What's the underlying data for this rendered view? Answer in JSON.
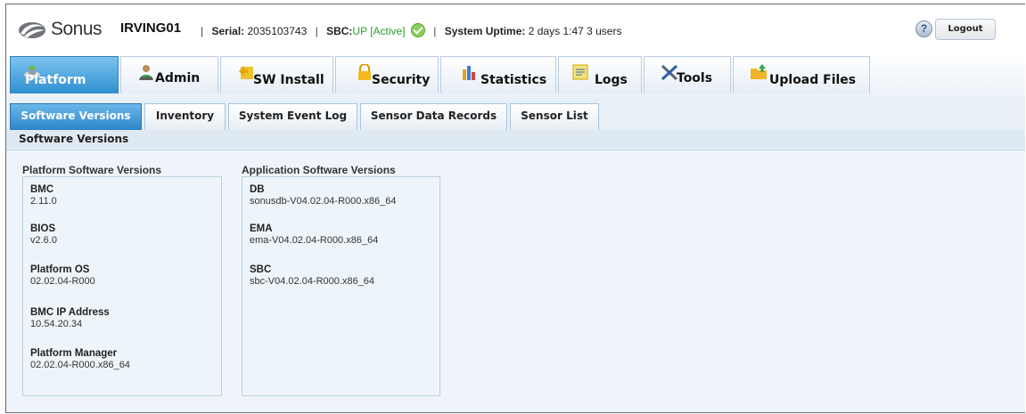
{
  "header": {
    "brand": "Sonus",
    "hostname": "IRVING01",
    "serial_label": "Serial:",
    "serial_value": "2035103743",
    "sbc_label": "SBC:",
    "sbc_status": "UP [Active]",
    "uptime_label": "System Uptime:",
    "uptime_value": "2 days 1:47 3 users",
    "separator": "|",
    "help_symbol": "?",
    "logout_label": "Logout",
    "colors": {
      "status_green": "#2e9d2e",
      "accent_blue": "#2f8fd0"
    }
  },
  "main_tabs": [
    {
      "label": "Platform",
      "icon": "platform-icon",
      "active": true
    },
    {
      "label": "Admin",
      "icon": "admin-user-icon",
      "active": false
    },
    {
      "label": "SW Install",
      "icon": "install-icon",
      "active": false
    },
    {
      "label": "Security",
      "icon": "lock-icon",
      "active": false
    },
    {
      "label": "Statistics",
      "icon": "bar-chart-icon",
      "active": false
    },
    {
      "label": "Logs",
      "icon": "log-file-icon",
      "active": false
    },
    {
      "label": "Tools",
      "icon": "tools-icon",
      "active": false
    },
    {
      "label": "Upload Files",
      "icon": "upload-folder-icon",
      "active": false
    }
  ],
  "sub_tabs": [
    {
      "label": "Software Versions",
      "active": true
    },
    {
      "label": "Inventory",
      "active": false
    },
    {
      "label": "System Event Log",
      "active": false
    },
    {
      "label": "Sensor Data Records",
      "active": false
    },
    {
      "label": "Sensor List",
      "active": false
    }
  ],
  "section_title": "Software Versions",
  "platform_panel": {
    "title": "Platform Software Versions",
    "items": [
      {
        "key": "BMC",
        "value": "2.11.0"
      },
      {
        "key": "BIOS",
        "value": "v2.6.0"
      },
      {
        "key": "Platform OS",
        "value": "02.02.04-R000"
      },
      {
        "key": "BMC IP Address",
        "value": "10.54.20.34"
      },
      {
        "key": "Platform Manager",
        "value": "02.02.04-R000.x86_64"
      }
    ]
  },
  "application_panel": {
    "title": "Application Software Versions",
    "items": [
      {
        "key": "DB",
        "value": "sonusdb-V04.02.04-R000.x86_64"
      },
      {
        "key": "EMA",
        "value": "ema-V04.02.04-R000.x86_64"
      },
      {
        "key": "SBC",
        "value": "sbc-V04.02.04-R000.x86_64"
      }
    ]
  }
}
